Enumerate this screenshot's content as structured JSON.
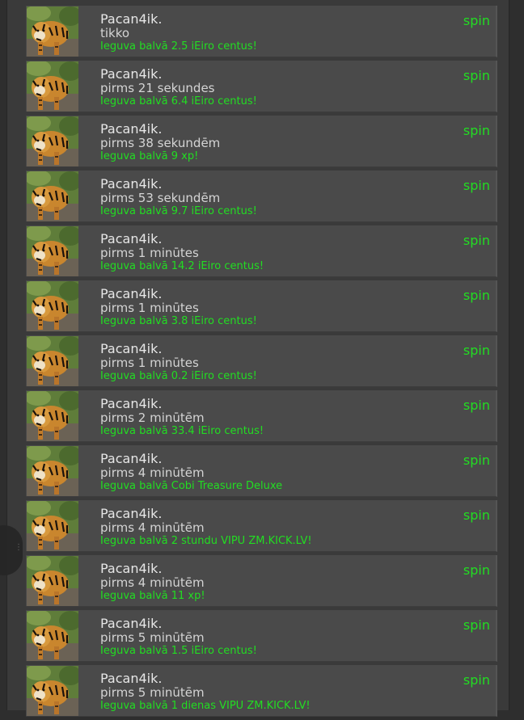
{
  "colors": {
    "accent_green": "#22dd22",
    "row_bg": "#4a4a4a",
    "panel_bg": "#3a3a3a"
  },
  "feed": {
    "spin_label": "spin",
    "avatar_icon": "tiger-avatar-icon",
    "items": [
      {
        "user": "Pacan4ik.",
        "time": "tikko",
        "prize": "Ieguva balvā 2.5 iEiro centus!"
      },
      {
        "user": "Pacan4ik.",
        "time": "pirms 21 sekundes",
        "prize": "Ieguva balvā 6.4 iEiro centus!"
      },
      {
        "user": "Pacan4ik.",
        "time": "pirms 38 sekundēm",
        "prize": "Ieguva balvā 9 xp!"
      },
      {
        "user": "Pacan4ik.",
        "time": "pirms 53 sekundēm",
        "prize": "Ieguva balvā 9.7 iEiro centus!"
      },
      {
        "user": "Pacan4ik.",
        "time": "pirms 1 minūtes",
        "prize": "Ieguva balvā 14.2 iEiro centus!"
      },
      {
        "user": "Pacan4ik.",
        "time": "pirms 1 minūtes",
        "prize": "Ieguva balvā 3.8 iEiro centus!"
      },
      {
        "user": "Pacan4ik.",
        "time": "pirms 1 minūtes",
        "prize": "Ieguva balvā 0.2 iEiro centus!"
      },
      {
        "user": "Pacan4ik.",
        "time": "pirms 2 minūtēm",
        "prize": "Ieguva balvā 33.4 iEiro centus!"
      },
      {
        "user": "Pacan4ik.",
        "time": "pirms 4 minūtēm",
        "prize": "Ieguva balvā Cobi Treasure Deluxe"
      },
      {
        "user": "Pacan4ik.",
        "time": "pirms 4 minūtēm",
        "prize": "Ieguva balvā 2 stundu VIPU ZM.KICK.LV!"
      },
      {
        "user": "Pacan4ik.",
        "time": "pirms 4 minūtēm",
        "prize": "Ieguva balvā 11 xp!"
      },
      {
        "user": "Pacan4ik.",
        "time": "pirms 5 minūtēm",
        "prize": "Ieguva balvā 1.5 iEiro centus!"
      },
      {
        "user": "Pacan4ik.",
        "time": "pirms 5 minūtēm",
        "prize": "Ieguva balvā 1 dienas VIPU ZM.KICK.LV!"
      }
    ]
  }
}
